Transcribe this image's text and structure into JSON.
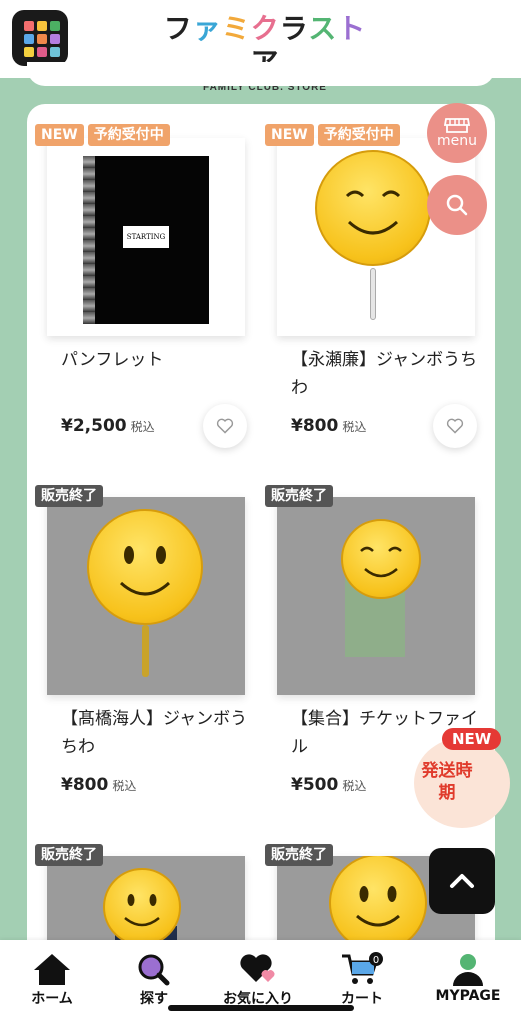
{
  "header": {
    "logo_main_chars": [
      "フ",
      "ァ",
      "ミ",
      "ク",
      "ラ",
      "ス",
      "ト",
      "ア"
    ],
    "logo_sub": "FAMILY CLUB. STORE",
    "app_icon_colors": [
      "#f36e6e",
      "#f7c23c",
      "#4caf63",
      "#5aa7e8",
      "#f0884a",
      "#b37ee0",
      "#f4d03f",
      "#e05c8a",
      "#6fc3d8"
    ]
  },
  "products": [
    {
      "badges": [
        "NEW",
        "予約受付中"
      ],
      "title": "パンフレット",
      "price": "¥2,500",
      "tax": "税込",
      "sold_out": false
    },
    {
      "badges": [
        "NEW",
        "予約受付中"
      ],
      "title": "【永瀬廉】ジャンボうちわ",
      "price": "¥800",
      "tax": "税込",
      "sold_out": false
    },
    {
      "badges": [
        "販売終了"
      ],
      "title": "【髙橋海人】ジャンボうちわ",
      "price": "¥800",
      "tax": "税込",
      "sold_out": true
    },
    {
      "badges": [
        "販売終了"
      ],
      "title": "【集合】チケットファイル",
      "price": "¥500",
      "tax": "税込",
      "sold_out": true
    },
    {
      "badges": [
        "販売終了"
      ],
      "title": "",
      "price": "",
      "tax": "",
      "sold_out": true
    },
    {
      "badges": [
        "販売終了"
      ],
      "title": "",
      "price": "",
      "tax": "",
      "sold_out": true
    }
  ],
  "floating": {
    "menu_label": "menu",
    "ship_new": "NEW",
    "ship_text": "発送時期"
  },
  "booklet_label": "STARTING",
  "bottom_nav": [
    {
      "label": "ホーム",
      "icon": "home-icon"
    },
    {
      "label": "探す",
      "icon": "search-icon"
    },
    {
      "label": "お気に入り",
      "icon": "heart-icon"
    },
    {
      "label": "カート",
      "icon": "cart-icon",
      "count": "0"
    },
    {
      "label": "MYPAGE",
      "icon": "user-icon"
    }
  ],
  "colors": {
    "background": "#a3cfb3",
    "accent": "#eb9088",
    "badge_orange": "#f0a36a",
    "badge_sold": "#555555"
  }
}
